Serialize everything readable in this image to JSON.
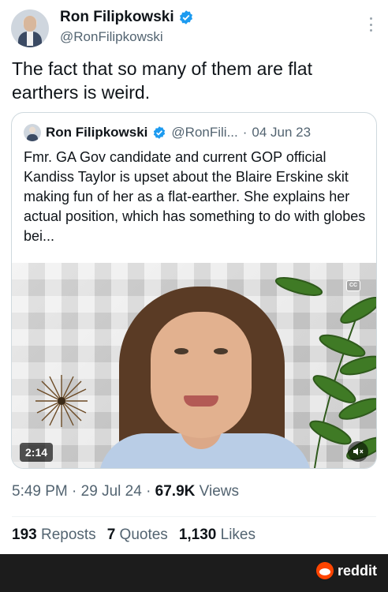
{
  "tweet": {
    "author_name": "Ron Filipkowski",
    "author_handle": "@RonFilipkowski",
    "text": "The fact that so many of them are flat earthers is weird.",
    "time": "5:49 PM",
    "date": "29 Jul 24",
    "views_count": "67.9K",
    "views_label": "Views",
    "reposts_count": "193",
    "reposts_label": "Reposts",
    "quotes_count": "7",
    "quotes_label": "Quotes",
    "likes_count": "1,130",
    "likes_label": "Likes"
  },
  "quote": {
    "author_name": "Ron Filipkowski",
    "author_handle": "@RonFili...",
    "date": "04 Jun 23",
    "text": "Fmr. GA Gov candidate and current GOP official Kandiss Taylor is upset about the Blaire Erskine skit making fun of her as a flat-earther. She explains her actual position, which has something to do with globes bei...",
    "video_duration": "2:14",
    "cc_label": "CC"
  },
  "footer": {
    "brand": "reddit"
  },
  "icons": {
    "verified": "verified-badge-icon",
    "more": "more-options-icon",
    "mute": "muted-speaker-icon",
    "captions": "closed-captions-icon",
    "reddit": "reddit-logo-icon"
  },
  "colors": {
    "verified": "#1d9bf0",
    "secondary_text": "#536471",
    "reddit": "#ff4500"
  }
}
